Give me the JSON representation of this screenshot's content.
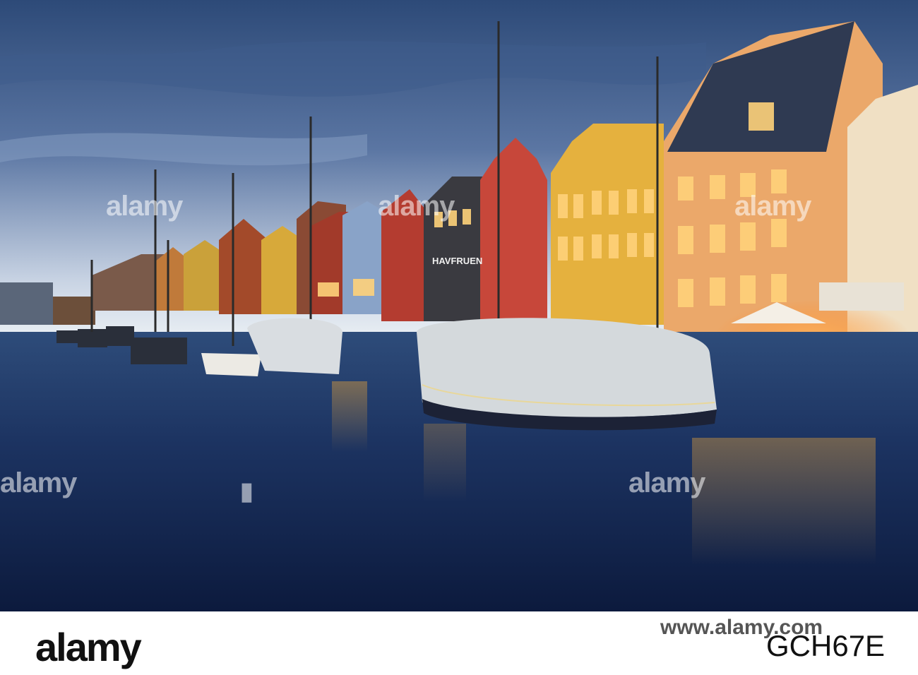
{
  "photo": {
    "sign_text": "HAVFRUEN",
    "watermark": "alamy"
  },
  "footer": {
    "brand": "alamy",
    "image_ref": "GCH67E",
    "site": "www.alamy.com"
  }
}
